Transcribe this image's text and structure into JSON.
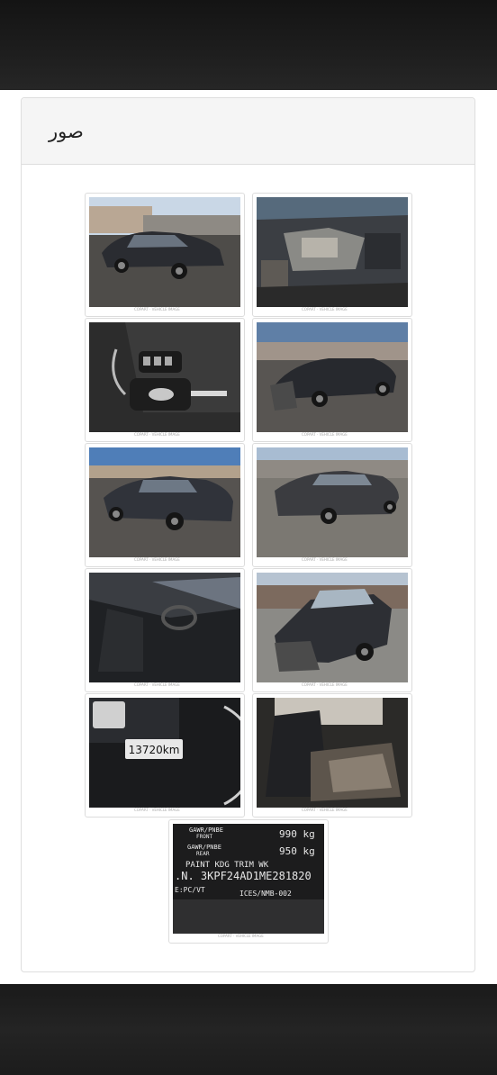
{
  "section": {
    "title": "صور"
  },
  "photos": [
    {
      "name": "photo-front-left-exterior"
    },
    {
      "name": "photo-engine-bay"
    },
    {
      "name": "photo-keys"
    },
    {
      "name": "photo-front-damage"
    },
    {
      "name": "photo-rear-left-exterior"
    },
    {
      "name": "photo-rear-right-exterior"
    },
    {
      "name": "photo-driver-interior"
    },
    {
      "name": "photo-front-right-damage"
    },
    {
      "name": "photo-odometer",
      "odometer": "13720km"
    },
    {
      "name": "photo-rear-seats"
    },
    {
      "name": "photo-vin-label",
      "label_lines": [
        "GAWR/PNBE",
        "FRONT",
        "990 kg",
        "GAWR/PNBE",
        "REAR",
        "950 kg",
        "PAINT KDG TRIM WK",
        ".N. 3KPF24AD1ME281820",
        "E:PC/VT",
        "ICES/NMB-002"
      ]
    }
  ]
}
